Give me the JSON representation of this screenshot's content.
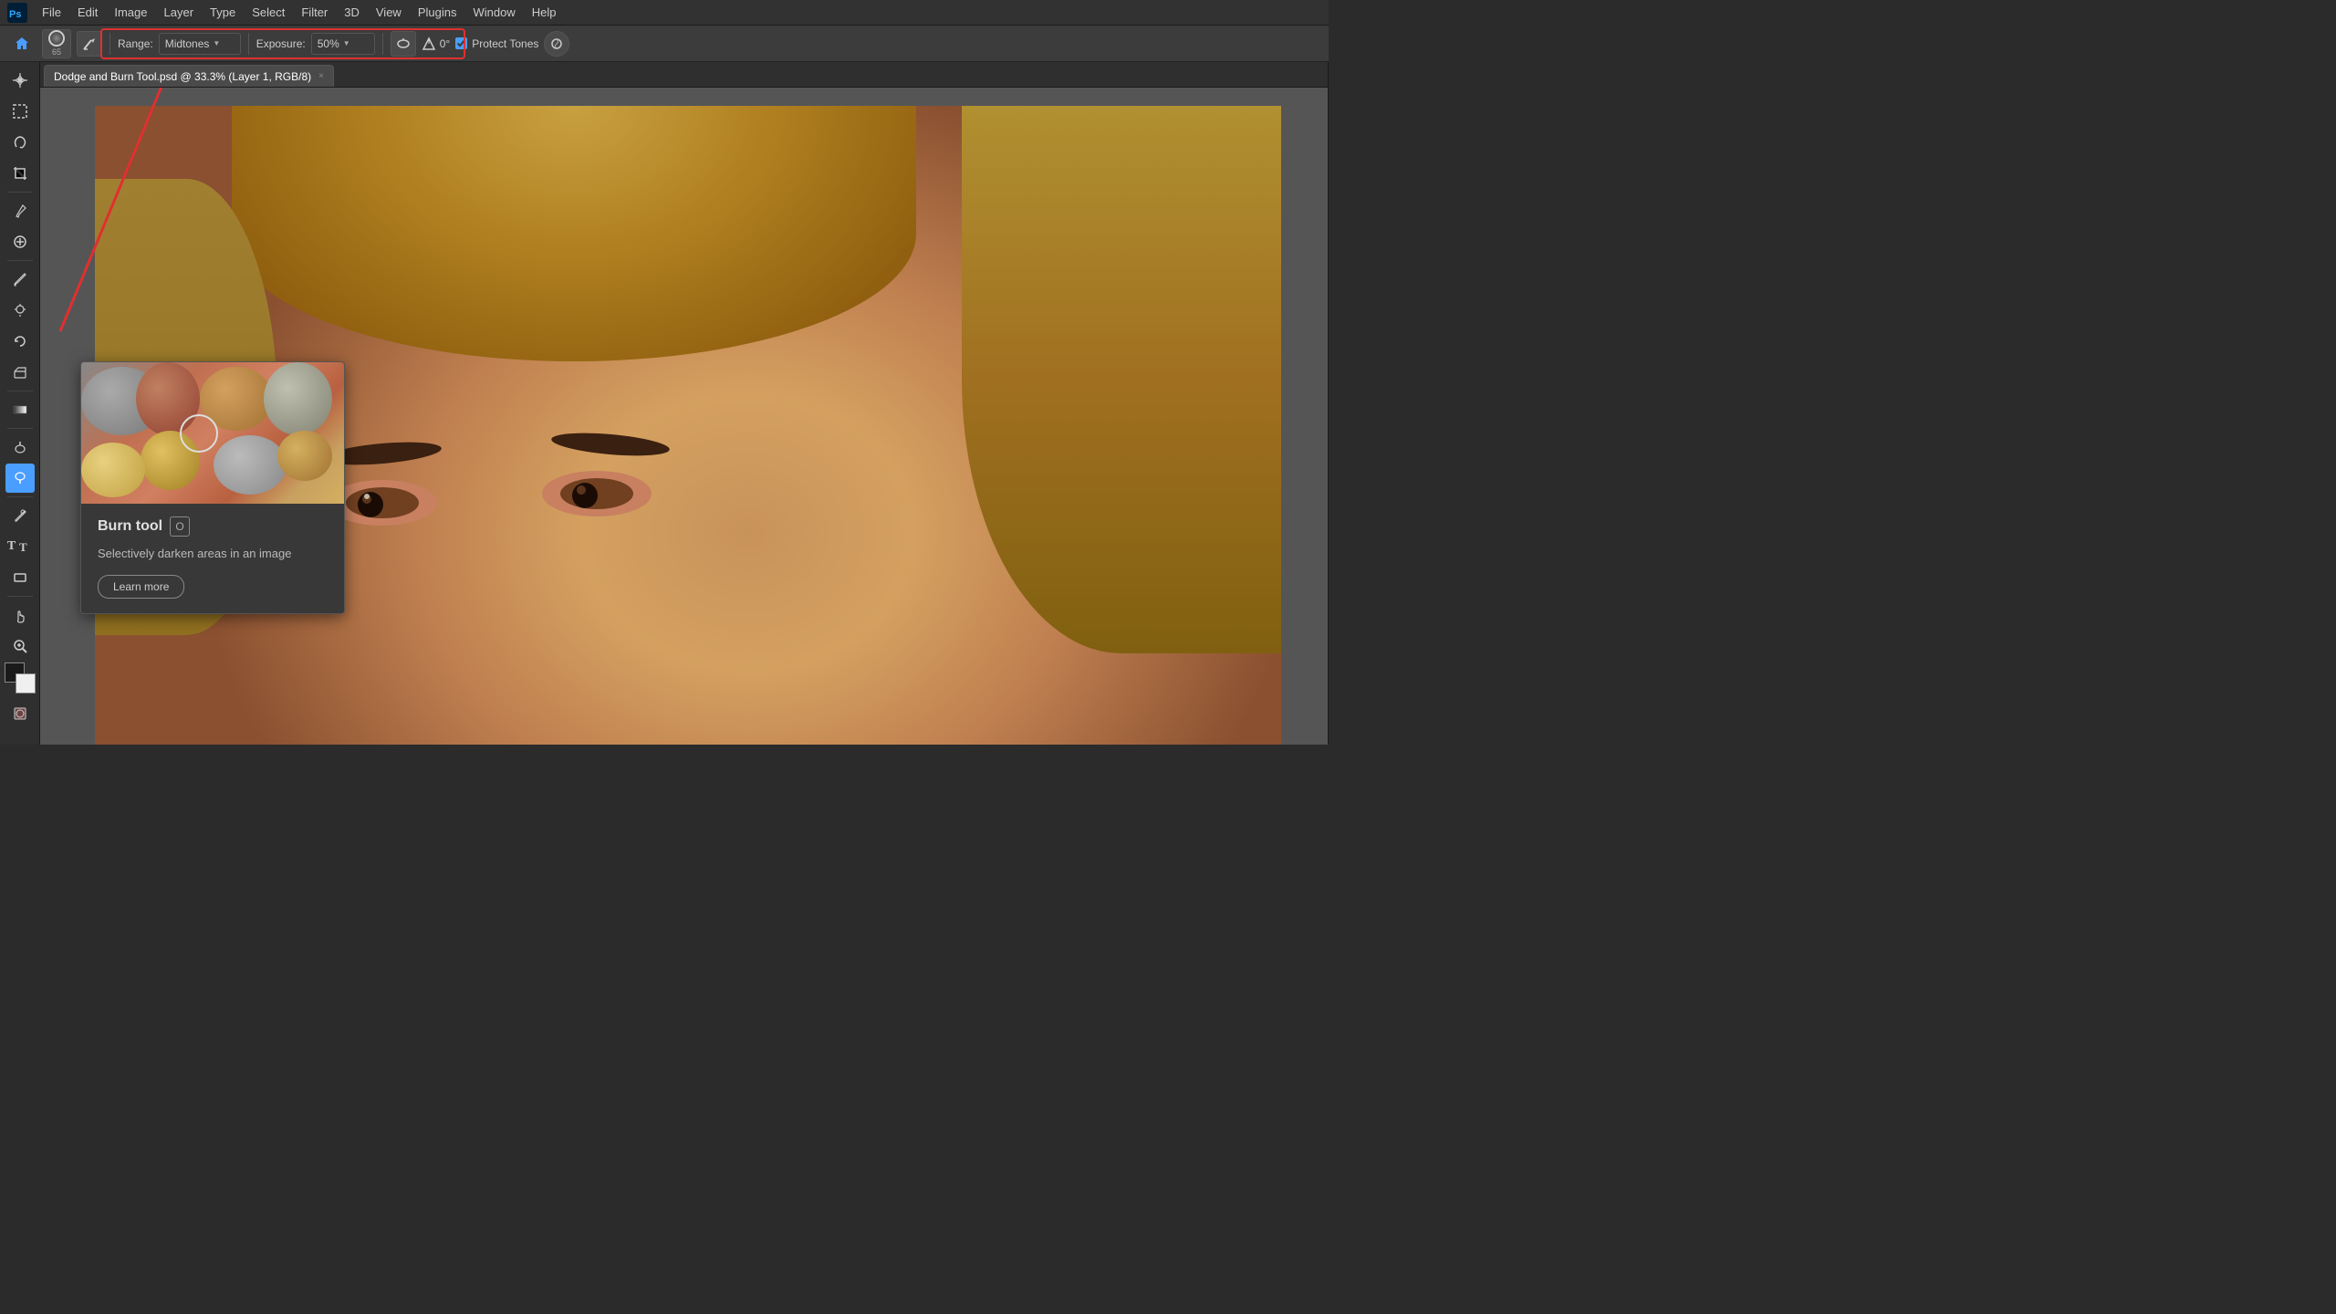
{
  "app": {
    "title": "Adobe Photoshop"
  },
  "menu": {
    "items": [
      "File",
      "Edit",
      "Image",
      "Layer",
      "Type",
      "Select",
      "Filter",
      "3D",
      "View",
      "Plugins",
      "Window",
      "Help"
    ]
  },
  "options_bar": {
    "brush_size": "65",
    "range_label": "Range:",
    "range_value": "Midtones",
    "exposure_label": "Exposure:",
    "exposure_value": "50%",
    "angle_label": "0°",
    "protect_tones_label": "Protect Tones",
    "protect_tones_checked": true
  },
  "tab": {
    "title": "Dodge and Burn Tool.psd @ 33.3% (Layer 1, RGB/8)",
    "close": "×"
  },
  "left_tools": [
    {
      "name": "move",
      "icon": "✥"
    },
    {
      "name": "marquee",
      "icon": "⬜"
    },
    {
      "name": "lasso",
      "icon": "⌒"
    },
    {
      "name": "crop",
      "icon": "⊡"
    },
    {
      "name": "eyedropper",
      "icon": "✒"
    },
    {
      "name": "healing",
      "icon": "⊕"
    },
    {
      "name": "brush",
      "icon": "🖌"
    },
    {
      "name": "clone",
      "icon": "🖃"
    },
    {
      "name": "history-brush",
      "icon": "↩"
    },
    {
      "name": "eraser",
      "icon": "◻"
    },
    {
      "name": "gradient",
      "icon": "▦"
    },
    {
      "name": "dodge",
      "icon": "◯"
    },
    {
      "name": "burn",
      "icon": "⬡",
      "active": true
    },
    {
      "name": "pen",
      "icon": "✒"
    },
    {
      "name": "type",
      "icon": "T"
    },
    {
      "name": "shape",
      "icon": "▭"
    },
    {
      "name": "hand",
      "icon": "☰"
    },
    {
      "name": "zoom",
      "icon": "🔍"
    }
  ],
  "tooltip": {
    "tool_name": "Burn tool",
    "shortcut": "O",
    "description": "Selectively darken areas in an image",
    "learn_more": "Learn more"
  },
  "colors": {
    "foreground": "#000000",
    "background": "#ffffff",
    "accent": "#4a9eff",
    "border_highlight": "#e03030"
  }
}
